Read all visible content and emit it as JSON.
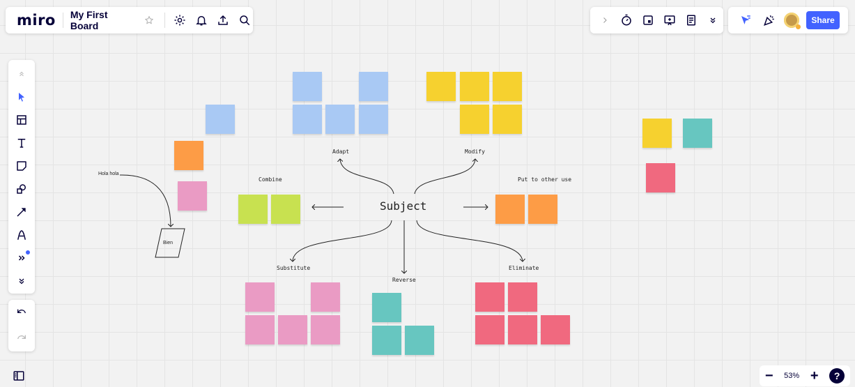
{
  "header": {
    "logo": "miro",
    "board_title": "My First Board",
    "icons": [
      "star-icon",
      "settings-icon",
      "bell-icon",
      "upload-icon",
      "search-icon"
    ]
  },
  "toolbar_right": {
    "icons": [
      "chevron-right-icon",
      "timer-icon",
      "card-icon",
      "present-icon",
      "notes-icon",
      "chevrons-down-icon"
    ]
  },
  "collab": {
    "share_label": "Share",
    "icons": [
      "cursor-filter-icon",
      "celebrate-icon",
      "avatar"
    ]
  },
  "left_tools": [
    "collapse-up-icon",
    "select-icon",
    "templates-icon",
    "text-icon",
    "sticky-note-icon",
    "shapes-icon",
    "line-icon",
    "pen-icon",
    "more-tools-icon",
    "chevrons-down-icon"
  ],
  "zoom": {
    "level": "53%",
    "minus": "−",
    "plus": "+",
    "help": "?"
  },
  "canvas": {
    "center_label": "Subject",
    "labels": {
      "adapt": "Adapt",
      "modify": "Modify",
      "combine": "Combine",
      "put_to_other_use": "Put to other use",
      "substitute": "Substitute",
      "reverse": "Reverse",
      "eliminate": "Eliminate",
      "hola": "Hola hola",
      "bien": "Bien"
    }
  },
  "colors": {
    "blue": "#a9c9f4",
    "yellow": "#f6d12f",
    "orange": "#fd9c46",
    "pink": "#ea9bc4",
    "green": "#c8e150",
    "teal": "#67c6c0",
    "red": "#f0697f",
    "accent": "#4262ff"
  }
}
